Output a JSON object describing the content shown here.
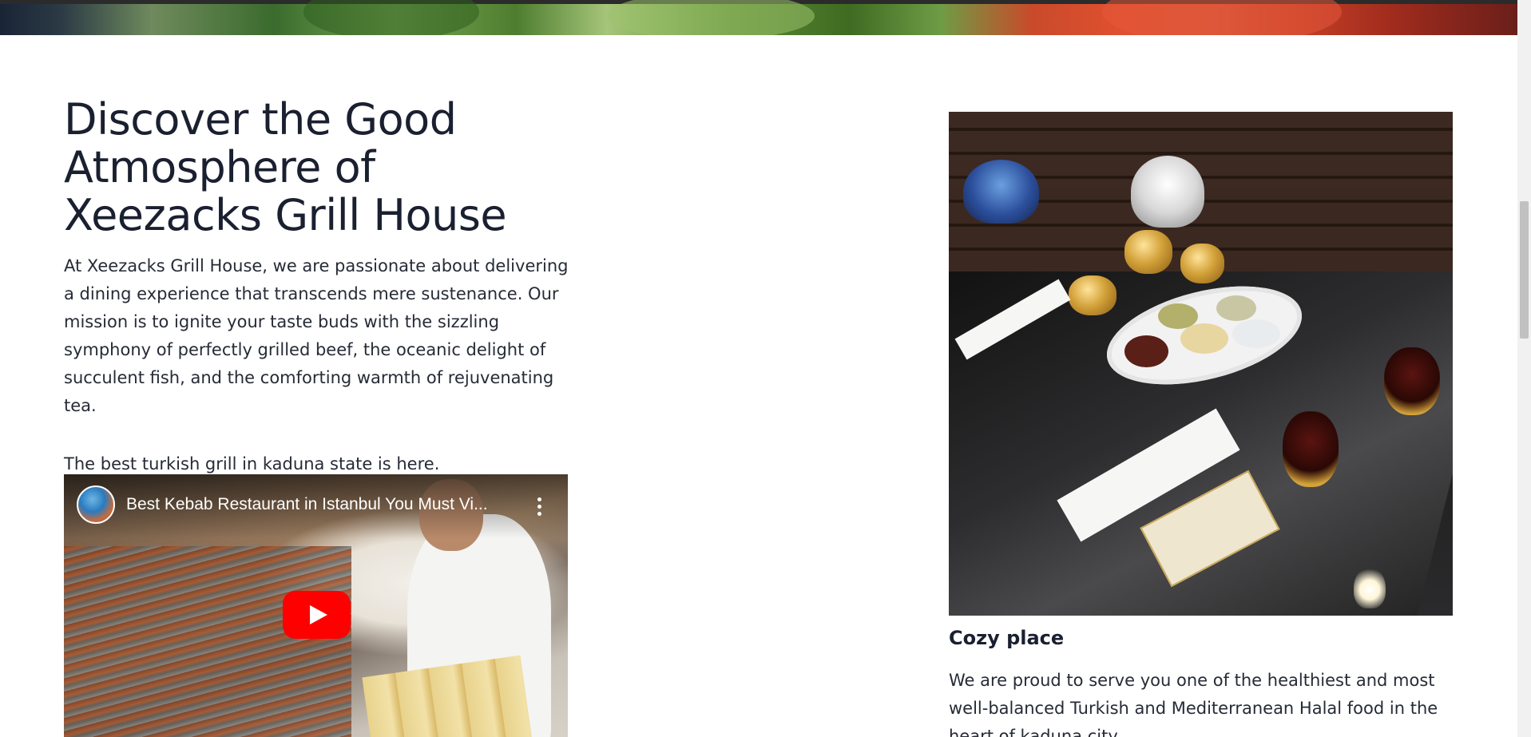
{
  "about": {
    "heading": "Discover the Good Atmosphere of Xeezacks Grill House",
    "intro": "At Xeezacks Grill House, we are passionate about delivering a dining experience that transcends mere sustenance. Our mission is to ignite your taste buds with the sizzling symphony of perfectly grilled beef, the oceanic delight of succulent fish, and the comforting warmth of rejuvenating tea.",
    "tagline": "The best turkish grill in kaduna state is here."
  },
  "video": {
    "title": "Best Kebab Restaurant in Istanbul You Must Vi...",
    "channel_icon": "channel-avatar",
    "menu_icon": "more-vert-icon",
    "play_icon": "youtube-play-icon",
    "play_color": "#ff0000"
  },
  "feature": {
    "image_subject": "restaurant-table-photo",
    "title": "Cozy place",
    "text": "We are proud to serve you one of the healthiest and most well-balanced Turkish and Mediterranean Halal food in the heart of kaduna city."
  },
  "colors": {
    "heading": "#1a2030",
    "body_text": "#262b36",
    "background": "#ffffff"
  }
}
